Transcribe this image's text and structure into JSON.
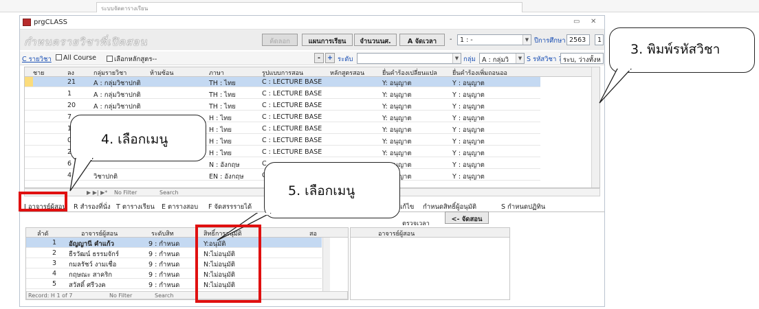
{
  "app": {
    "top_tab_text": "ระบบจัดตารางเรียน",
    "window_title": "prgCLASS",
    "header_logo": "กำหนดรายวิชาที่เปิดสอน"
  },
  "toolbar": {
    "btn_check": "ค้ดลอก",
    "btn_plan": "แผนการเรียน",
    "btn_count": "จำนวนนศ.",
    "btn_schedule": "A จัดเวลา",
    "combo_term": "1 : -",
    "year_label": "ปีการศึกษา",
    "year_value": "2563",
    "term_value": "1"
  },
  "filter": {
    "course_label": "C รายวิชา",
    "all_course": "All Course",
    "select_curriculum": "เลือกหลักสูตร--",
    "level_label": "ระดับ",
    "group_label": "กลุ่ม",
    "group_value": "A : กลุ่มวิ",
    "code_label": "S รหัสวิชา ? /*",
    "code_value": "ระบ, ว่างทั้งห"
  },
  "grid": {
    "headers": [
      "ชาย",
      "ลง",
      "กลุ่มรายวิชา",
      "ห้ามซ้อน",
      "ภาษา",
      "รูปแบบการสอน",
      "หลักสูตรสอน",
      "ยื่นคำร้องเปลี่ยนแปล",
      "ยื่นคำร้องเพิ่มถอนออ"
    ],
    "rows": [
      [
        "21",
        "A : กลุ่มวิชาปกติ",
        "TH : ไทย",
        "C : LECTURE BASE",
        "Y: อนุญาต",
        "Y : อนุญาต"
      ],
      [
        "1",
        "A : กลุ่มวิชาปกติ",
        "TH : ไทย",
        "C : LECTURE BASE",
        "Y: อนุญาต",
        "Y : อนุญาต"
      ],
      [
        "20",
        "A : กลุ่มวิชาปกติ",
        "TH : ไทย",
        "C : LECTURE BASE",
        "Y: อนุญาต",
        "Y : อนุญาต"
      ],
      [
        "7",
        "",
        "H : ไทย",
        "C : LECTURE BASE",
        "Y: อนุญาต",
        "Y : อนุญาต"
      ],
      [
        "15",
        "",
        "H : ไทย",
        "C : LECTURE BASE",
        "Y: อนุญาต",
        "Y : อนุญาต"
      ],
      [
        "0",
        "",
        "H : ไทย",
        "C : LECTURE BASE",
        "Y: อนุญาต",
        "Y : อนุญาต"
      ],
      [
        "25",
        "",
        "H : ไทย",
        "C : LECTURE BASE",
        "Y: อนุญาต",
        "Y : อนุญาต"
      ],
      [
        "6",
        "",
        "N : อังกฤษ",
        "C",
        "Y: อนุญาต",
        "Y : อนุญาต"
      ],
      [
        "4",
        "วิชาปกติ",
        "EN : อังกฤษ",
        "C",
        "Y: อนุญาต",
        "Y : อนุญาต"
      ]
    ]
  },
  "nav": {
    "no_filter": "No Filter",
    "search": "Search"
  },
  "tabs": {
    "t1": "I อาจารย์ผู้สอน",
    "t2": "R สำรองที่นั่ง",
    "t3": "T ตารางเรียน",
    "t4": "E ตารางสอบ",
    "t5": "F จัดสรรรายได้",
    "t6": "การแก้ไข",
    "t7": "กำหนดสิทธิ์ผู้อนุมัติ",
    "t8": "S กำหนดปฏิทิน"
  },
  "subform": {
    "headers": [
      "ลำดั",
      "อาจารย์ผู้สอน",
      "ระดับสิท",
      "สิทธิ์การอนุมัติ",
      "สอ"
    ],
    "rows": [
      [
        "1",
        "อัญญานี คำแก้ว",
        "9 : กำหนด",
        "Y:อนุมัติ"
      ],
      [
        "2",
        "ธีรวัฒน์ ธรรมจักร์",
        "9 : กำหนด",
        "N:ไม่อนุมัติ"
      ],
      [
        "3",
        "กมลรัชว์ งามเชื่อ",
        "9 : กำหนด",
        "N:ไม่อนุมัติ"
      ],
      [
        "4",
        "กฤษณะ สาคริก",
        "9 : กำหนด",
        "N:ไม่อนุมัติ"
      ],
      [
        "5",
        "สวัสดิ์ ศรีวงค",
        "9 : กำหนด",
        "N:ไม่อนุมัติ"
      ]
    ],
    "record": "Record: H  1 of 7",
    "no_filter": "No Filter",
    "search": "Search",
    "check_time": "ตรวจเวลา",
    "assign_btn": "<- จัดสอน",
    "right_header": "อาจารย์ผู้สอน"
  },
  "callouts": {
    "c3": "3. พิมพ์รหัสวิชา",
    "c4": "4. เลือกเมนู",
    "c5": "5. เลือกเมนู"
  },
  "colors": {
    "highlight": "#e01010",
    "selected_row": "#c4d9f2"
  }
}
